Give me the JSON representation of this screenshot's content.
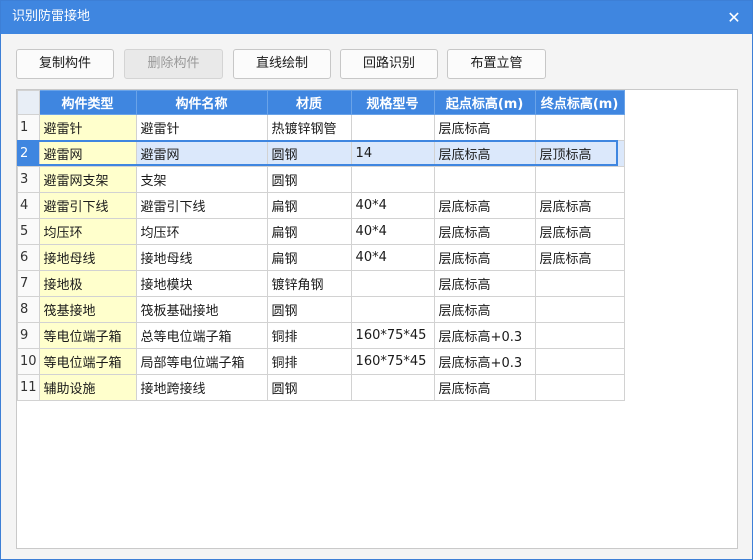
{
  "window": {
    "title": "识别防雷接地",
    "close_glyph": "✕"
  },
  "toolbar": {
    "buttons": [
      {
        "label": "复制构件",
        "enabled": true
      },
      {
        "label": "删除构件",
        "enabled": false
      },
      {
        "label": "直线绘制",
        "enabled": true
      },
      {
        "label": "回路识别",
        "enabled": true
      },
      {
        "label": "布置立管",
        "enabled": true
      }
    ]
  },
  "table": {
    "columns": [
      "构件类型",
      "构件名称",
      "材质",
      "规格型号",
      "起点标高(m)",
      "终点标高(m)"
    ],
    "selected_row": 2,
    "rows": [
      {
        "n": "1",
        "cells": [
          "避雷针",
          "避雷针",
          "热镀锌钢管",
          "",
          "层底标高",
          ""
        ]
      },
      {
        "n": "2",
        "cells": [
          "避雷网",
          "避雷网",
          "圆钢",
          "14",
          "层底标高",
          "层顶标高"
        ]
      },
      {
        "n": "3",
        "cells": [
          "避雷网支架",
          "支架",
          "圆钢",
          "",
          "",
          ""
        ]
      },
      {
        "n": "4",
        "cells": [
          "避雷引下线",
          "避雷引下线",
          "扁钢",
          "40*4",
          "层底标高",
          "层底标高"
        ]
      },
      {
        "n": "5",
        "cells": [
          "均压环",
          "均压环",
          "扁钢",
          "40*4",
          "层底标高",
          "层底标高"
        ]
      },
      {
        "n": "6",
        "cells": [
          "接地母线",
          "接地母线",
          "扁钢",
          "40*4",
          "层底标高",
          "层底标高"
        ]
      },
      {
        "n": "7",
        "cells": [
          "接地极",
          "接地模块",
          "镀锌角钢",
          "",
          "层底标高",
          ""
        ]
      },
      {
        "n": "8",
        "cells": [
          "筏基接地",
          "筏板基础接地",
          "圆钢",
          "",
          "层底标高",
          ""
        ]
      },
      {
        "n": "9",
        "cells": [
          "等电位端子箱",
          "总等电位端子箱",
          "铜排",
          "160*75*45",
          "层底标高+0.3",
          ""
        ]
      },
      {
        "n": "10",
        "cells": [
          "等电位端子箱",
          "局部等电位端子箱",
          "铜排",
          "160*75*45",
          "层底标高+0.3",
          ""
        ]
      },
      {
        "n": "11",
        "cells": [
          "辅助设施",
          "接地跨接线",
          "圆钢",
          "",
          "层底标高",
          ""
        ]
      }
    ]
  },
  "colors": {
    "accent": "#3f86e0",
    "type_cell_bg": "#ffffcc",
    "selected_row_bg": "#dbe8fb"
  }
}
